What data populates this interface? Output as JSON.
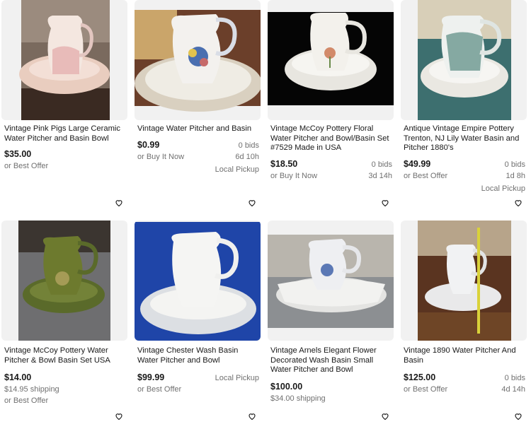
{
  "listings": [
    {
      "title": "Vintage Pink Pigs Large Ceramic Water Pitcher and Basin Bowl",
      "price": "$35.00",
      "line2": "or Best Offer",
      "bids": "",
      "time": "",
      "pickup": ""
    },
    {
      "title": "Vintage Water Pitcher and Basin",
      "price": "$0.99",
      "line2": "or Buy It Now",
      "bids": "0 bids",
      "time": "6d 10h",
      "pickup": "Local Pickup"
    },
    {
      "title": "Vintage McCoy Pottery Floral Water Pitcher and Bowl/Basin Set #7529 Made in USA",
      "price": "$18.50",
      "line2": "or Buy It Now",
      "bids": "0 bids",
      "time": "3d 14h",
      "pickup": ""
    },
    {
      "title": "Antique Vintage Empire Pottery Trenton, NJ Lily Water Basin and Pitcher 1880's",
      "price": "$49.99",
      "line2": "or Best Offer",
      "bids": "0 bids",
      "time": "1d 8h",
      "pickup": "Local Pickup"
    },
    {
      "title": "Vintage McCoy Pottery Water Pitcher & Bowl Basin Set USA",
      "price": "$14.00",
      "shipping": "$14.95 shipping",
      "line3": "or Best Offer"
    },
    {
      "title": "Vintage Chester Wash Basin Water Pitcher and Bowl",
      "price": "$99.99",
      "line2": "or Best Offer",
      "pickup": "Local Pickup"
    },
    {
      "title": "Vintage Arnels Elegant Flower Decorated Wash Basin Small Water Pitcher and Bowl",
      "price": "$100.00",
      "shipping": "$34.00 shipping"
    },
    {
      "title": "Vintage 1890 Water Pitcher And Basin",
      "price": "$125.00",
      "line2": "or Best Offer",
      "bids": "0 bids",
      "time": "4d 14h"
    }
  ],
  "icons": {
    "favorite": "heart-outline-icon"
  }
}
